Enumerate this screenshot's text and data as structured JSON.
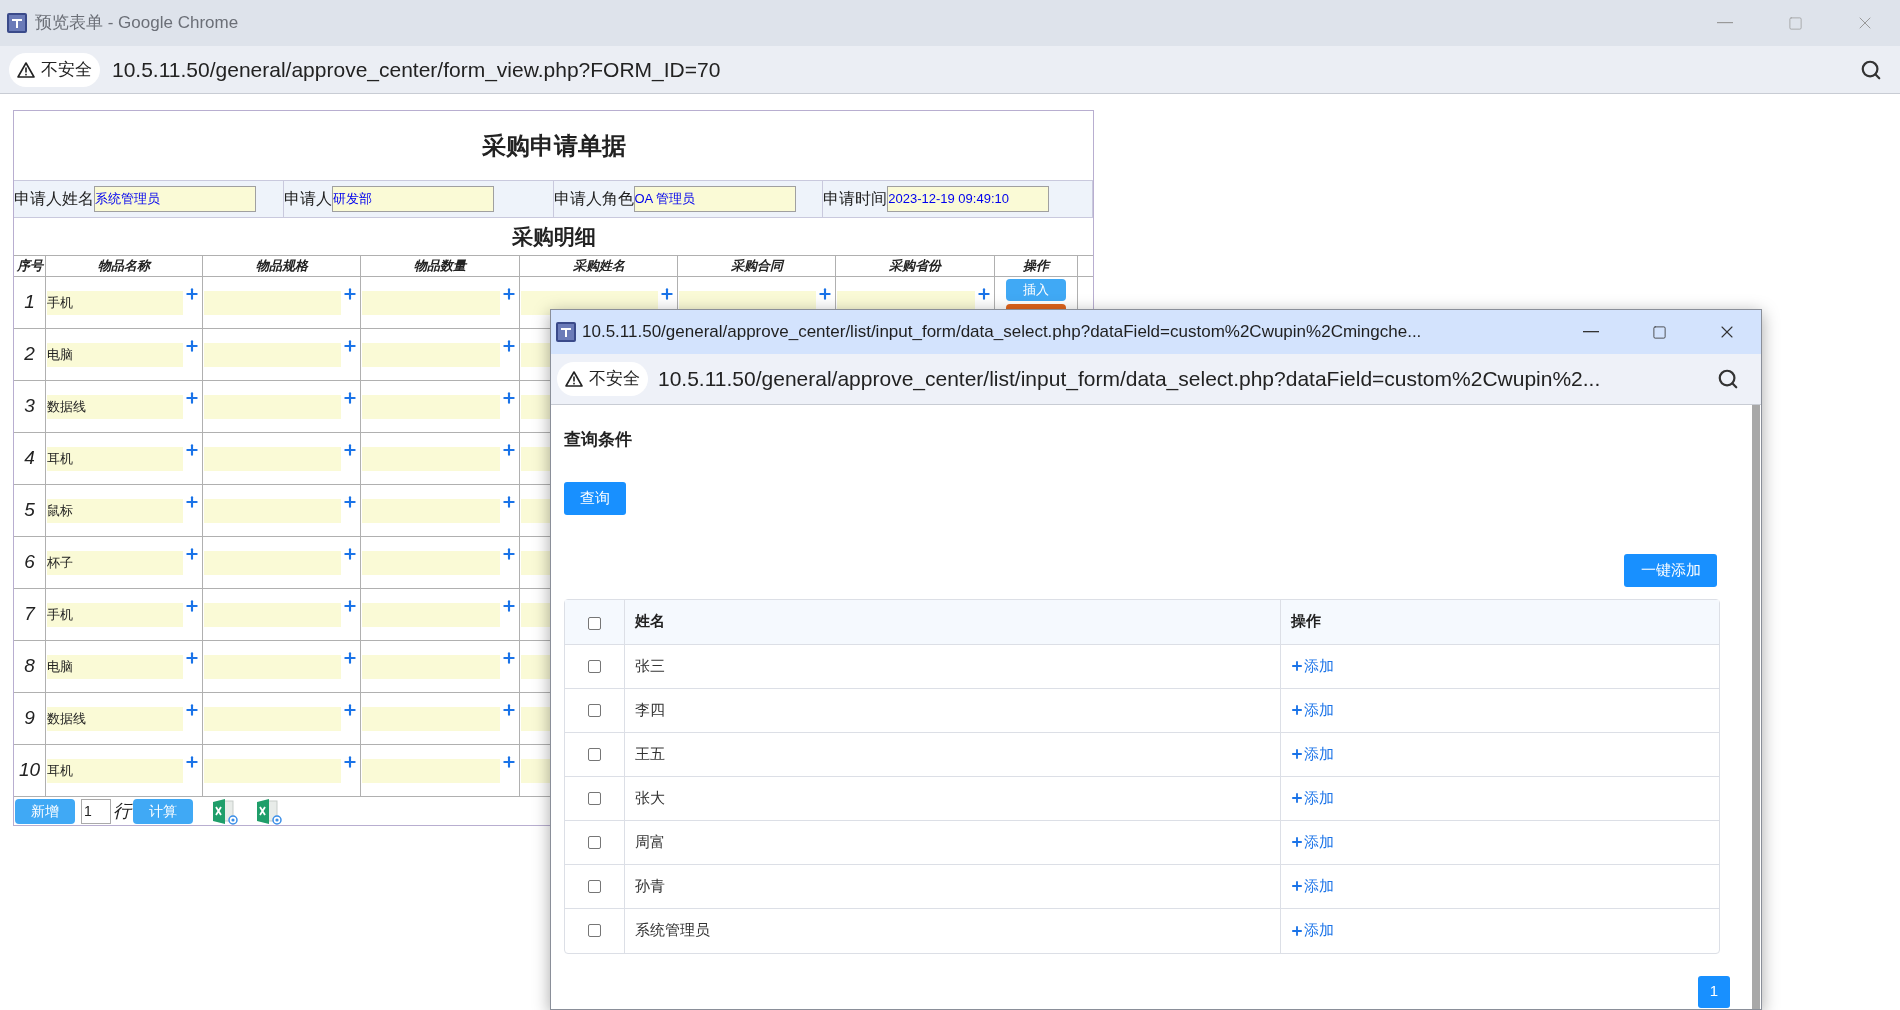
{
  "browser": {
    "title": "预览表单 - Google Chrome",
    "security": "不安全",
    "url": "10.5.11.50/general/approve_center/form_view.php?FORM_ID=70"
  },
  "form": {
    "title": "采购申请单据",
    "fields": [
      {
        "label": "申请人姓名",
        "value": "系统管理员"
      },
      {
        "label": "申请人",
        "value": "研发部"
      },
      {
        "label": "申请人角色",
        "value": "OA 管理员"
      },
      {
        "label": "申请时间",
        "value": "2023-12-19 09:49:10"
      }
    ],
    "section_title": "采购明细",
    "columns": [
      "序号",
      "物品名称",
      "物品规格",
      "物品数量",
      "采购姓名",
      "采购合同",
      "采购省份",
      "操作"
    ],
    "row_action": "插入",
    "rows": [
      {
        "number": "1",
        "item": "手机"
      },
      {
        "number": "2",
        "item": "电脑"
      },
      {
        "number": "3",
        "item": "数据线"
      },
      {
        "number": "4",
        "item": "耳机"
      },
      {
        "number": "5",
        "item": "鼠标"
      },
      {
        "number": "6",
        "item": "杯子"
      },
      {
        "number": "7",
        "item": "手机"
      },
      {
        "number": "8",
        "item": "电脑"
      },
      {
        "number": "9",
        "item": "数据线"
      },
      {
        "number": "10",
        "item": "耳机"
      }
    ],
    "footer": {
      "add_button": "新增",
      "row_count": "1",
      "row_unit": "行",
      "calc_button": "计算"
    }
  },
  "popup": {
    "title": "10.5.11.50/general/approve_center/list/input_form/data_select.php?dataField=custom%2Cwupin%2Cmingche...",
    "security": "不安全",
    "url": "10.5.11.50/general/approve_center/list/input_form/data_select.php?dataField=custom%2Cwupin%2...",
    "query_heading": "查询条件",
    "query_button": "查询",
    "add_all_button": "一键添加",
    "columns": [
      "姓名",
      "操作"
    ],
    "select_all_checked": false,
    "rows": [
      {
        "name": "张三",
        "checked": false,
        "action": "添加"
      },
      {
        "name": "李四",
        "checked": false,
        "action": "添加"
      },
      {
        "name": "王五",
        "checked": false,
        "action": "添加"
      },
      {
        "name": "张大",
        "checked": false,
        "action": "添加"
      },
      {
        "name": "周富",
        "checked": false,
        "action": "添加"
      },
      {
        "name": "孙青",
        "checked": false,
        "action": "添加"
      },
      {
        "name": "系统管理员",
        "checked": false,
        "action": "添加"
      }
    ],
    "pages": [
      {
        "label": "1",
        "selected": true
      }
    ]
  }
}
